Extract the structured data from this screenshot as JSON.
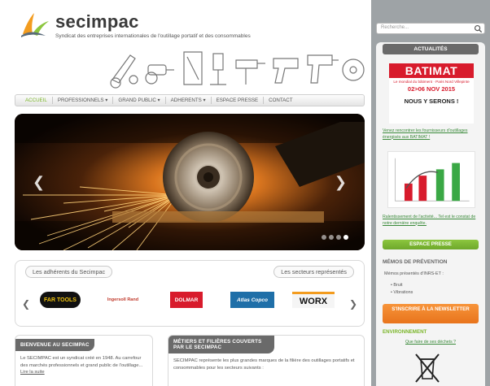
{
  "header": {
    "brand": "secimpac",
    "tagline": "Syndicat des entreprises internationales de l'outillage portatif et des consommables"
  },
  "nav": {
    "items": [
      {
        "label": "ACCUEIL",
        "active": true
      },
      {
        "label": "PROFESSIONNELS ▾",
        "active": false
      },
      {
        "label": "GRAND PUBLIC ▾",
        "active": false
      },
      {
        "label": "ADHERENTS ▾",
        "active": false
      },
      {
        "label": "ESPACE PRESSE",
        "active": false
      },
      {
        "label": "CONTACT",
        "active": false
      }
    ]
  },
  "slider": {
    "prev_icon": "chevron-left-icon",
    "next_icon": "chevron-right-icon",
    "slide_count": 4,
    "active_slide": 4
  },
  "members": {
    "left_tab": "Les adhérents du Secimpac",
    "right_tab": "Les secteurs représentés",
    "logos": [
      "FAR TOOLS",
      "Ingersoll Rand",
      "DOLMAR",
      "Atlas Copco",
      "WORX"
    ]
  },
  "boxes": {
    "welcome_title": "BIENVENUE AU SECIMPAC",
    "welcome_text": "Le SECIMPAC est un syndicat créé en 1948. Au carrefour des marchés professionnels et grand public de l'outillage...",
    "welcome_more": "Lire la suite",
    "careers_title": "MÉTIERS ET FILIÈRES COUVERTS PAR LE SECIMPAC",
    "careers_text": "SECIMPAC représente les plus grandes marques de la filière des outillages portatifs et consommables pour les secteurs suivants :"
  },
  "sidebar": {
    "search_placeholder": "Recherche...",
    "news_heading": "ACTUALITÉS",
    "batimat": {
      "name": "BATIMAT",
      "sub": "Le mondial du bâtiment · Paris Nord Villepinte",
      "dates": "02>06 NOV 2015",
      "cta": "NOUS Y SERONS !"
    },
    "link_batimat": "Venez rencontrer les fournisseurs d'outillages énergisés aux BATIMAT !",
    "link_activity": "Ralentissement de l'activité... Tel est le constat de notre dernière enquête.",
    "press_button": "ESPACE PRESSE",
    "prevention_heading": "MÉMOS DE PRÉVENTION",
    "prevention_intro": "Mémos présentés d'INRS-ET :",
    "prevention_items": [
      "Bruit",
      "Vibrations"
    ],
    "newsletter_button": "S'INSCRIRE À LA NEWSLETTER",
    "environment_heading": "ENVIRONNEMENT",
    "environment_link": "Que faire de ses déchets ?"
  },
  "colors": {
    "accent_green": "#7bb62a",
    "accent_orange": "#f7943a",
    "batimat_red": "#d81b2c",
    "sidebar_gray": "#9ea3a6"
  }
}
